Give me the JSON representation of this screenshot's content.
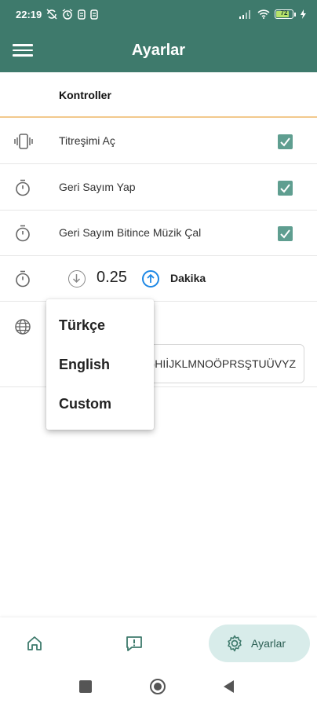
{
  "status_bar": {
    "time": "22:19",
    "left_icons": [
      "sync-off-icon",
      "alarm-icon",
      "notification-icon",
      "notification-icon"
    ],
    "right_icons": [
      "signal-icon",
      "wifi-icon",
      "battery-icon"
    ],
    "battery_level": "72"
  },
  "app_bar": {
    "title": "Ayarlar",
    "menu_icon": "hamburger-icon"
  },
  "settings": {
    "section_title": "Kontroller",
    "items": [
      {
        "label": "Titreşimi Aç",
        "icon": "vibration-icon",
        "checked": true
      },
      {
        "label": "Geri Sayım Yap",
        "icon": "timer-icon",
        "checked": true
      },
      {
        "label": "Geri Sayım Bitince Müzik Çal",
        "icon": "timer-icon",
        "checked": true
      }
    ],
    "countdown": {
      "icon": "timer-icon",
      "value": "0.25",
      "unit": "Dakika"
    },
    "language": {
      "icon": "globe-icon",
      "alphabet": "ABCÇDEFGĞHIİJKLMNOÖPRSŞTUÜVYZ"
    }
  },
  "language_menu": {
    "options": [
      "Türkçe",
      "English",
      "Custom"
    ]
  },
  "bottom_nav": {
    "items": [
      {
        "icon": "home-icon",
        "label": ""
      },
      {
        "icon": "feedback-icon",
        "label": ""
      },
      {
        "icon": "gear-icon",
        "label": "Ayarlar",
        "active": true
      }
    ]
  },
  "colors": {
    "primary": "#3e7a6c",
    "accent_line": "#f2c98d",
    "checkbox": "#5f9e90",
    "up_arrow": "#1e88e5",
    "active_nav_bg": "#d8ecea"
  }
}
